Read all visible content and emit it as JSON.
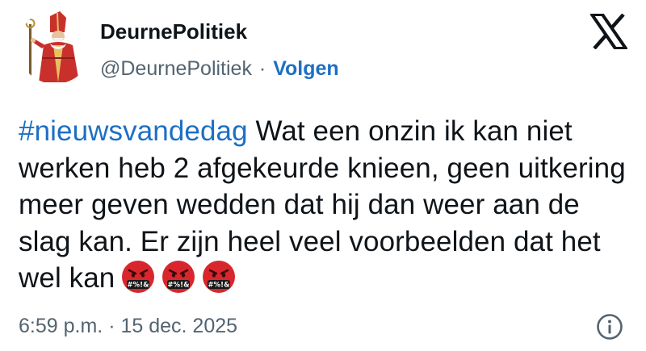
{
  "author": {
    "display_name": "DeurnePolitiek",
    "handle": "@DeurnePolitiek",
    "separator": "·",
    "follow_label": "Volgen"
  },
  "tweet": {
    "hashtag": "#nieuwsvandedag",
    "text": " Wat een onzin ik kan niet werken heb 2 afgekeurde knieen, geen uitkering meer geven wedden dat hij dan weer aan de slag kan. Er zijn heel veel voorbeelden dat het wel kan",
    "emojis": [
      "face-with-symbols-on-mouth",
      "face-with-symbols-on-mouth",
      "face-with-symbols-on-mouth"
    ],
    "emoji_symbol_text": "#%!&"
  },
  "meta": {
    "time": "6:59 p.m.",
    "separator": "·",
    "date": "15 dec. 2025"
  },
  "icons": {
    "platform_logo": "x-logo-icon",
    "info": "info-icon",
    "avatar": "bishop-figure-avatar"
  },
  "colors": {
    "link": "#1d6fc4",
    "secondary_text": "#536471",
    "primary_text": "#0f1419",
    "emoji_red": "#d9262e"
  }
}
